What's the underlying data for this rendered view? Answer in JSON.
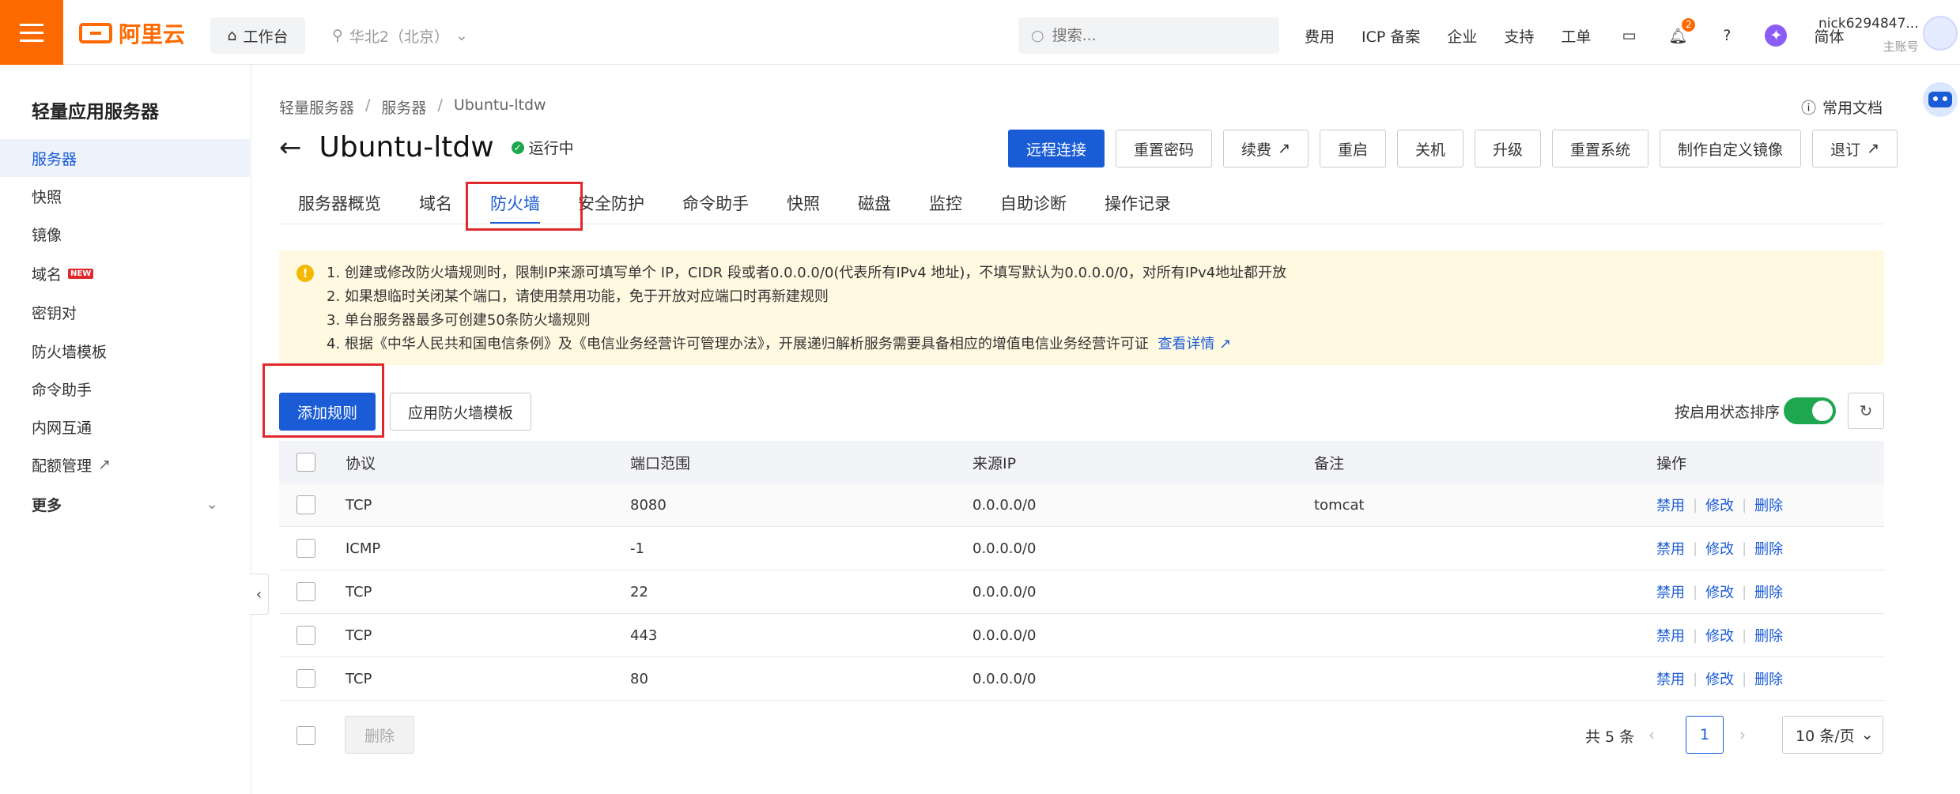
{
  "topbar": {
    "logo_text": "阿里云",
    "workbench": "工作台",
    "region": "华北2（北京）",
    "search_placeholder": "搜索...",
    "links": [
      "费用",
      "ICP 备案",
      "企业",
      "支持",
      "工单"
    ],
    "notification_count": "2",
    "language": "简体",
    "user_name": "nick6294847...",
    "user_role": "主账号"
  },
  "sidebar": {
    "title": "轻量应用服务器",
    "items": [
      {
        "label": "服务器",
        "active": true
      },
      {
        "label": "快照"
      },
      {
        "label": "镜像"
      },
      {
        "label": "域名",
        "tag": "NEW"
      },
      {
        "label": "密钥对"
      },
      {
        "label": "防火墙模板"
      },
      {
        "label": "命令助手"
      },
      {
        "label": "内网互通"
      },
      {
        "label": "配额管理",
        "external": true
      }
    ],
    "more": "更多"
  },
  "breadcrumb": [
    "轻量服务器",
    "服务器",
    "Ubuntu-ltdw"
  ],
  "help_doc": "常用文档",
  "header": {
    "title": "Ubuntu-ltdw",
    "status": "运行中"
  },
  "actions": [
    "远程连接",
    "重置密码",
    "续费",
    "重启",
    "关机",
    "升级",
    "重置系统",
    "制作自定义镜像",
    "退订"
  ],
  "tabs": [
    "服务器概览",
    "域名",
    "防火墙",
    "安全防护",
    "命令助手",
    "快照",
    "磁盘",
    "监控",
    "自助诊断",
    "操作记录"
  ],
  "active_tab": "防火墙",
  "notice": {
    "lines": [
      "1. 创建或修改防火墙规则时，限制IP来源可填写单个 IP，CIDR 段或者0.0.0.0/0(代表所有IPv4 地址)，不填写默认为0.0.0.0/0，对所有IPv4地址都开放",
      "2. 如果想临时关闭某个端口，请使用禁用功能，免于开放对应端口时再新建规则",
      "3. 单台服务器最多可创建50条防火墙规则",
      "4. 根据《中华人民共和国电信条例》及《电信业务经营许可管理办法》，开展递归解析服务需要具备相应的增值电信业务经营许可证"
    ],
    "link": "查看详情"
  },
  "toolbar": {
    "add_rule": "添加规则",
    "apply_template": "应用防火墙模板",
    "sort_label": "按启用状态排序"
  },
  "table": {
    "headers": [
      "协议",
      "端口范围",
      "来源IP",
      "备注",
      "操作"
    ],
    "rows": [
      {
        "protocol": "TCP",
        "port": "8080",
        "source": "0.0.0.0/0",
        "note": "tomcat"
      },
      {
        "protocol": "ICMP",
        "port": "-1",
        "source": "0.0.0.0/0",
        "note": ""
      },
      {
        "protocol": "TCP",
        "port": "22",
        "source": "0.0.0.0/0",
        "note": ""
      },
      {
        "protocol": "TCP",
        "port": "443",
        "source": "0.0.0.0/0",
        "note": ""
      },
      {
        "protocol": "TCP",
        "port": "80",
        "source": "0.0.0.0/0",
        "note": ""
      }
    ],
    "ops": [
      "禁用",
      "修改",
      "删除"
    ]
  },
  "footer": {
    "delete": "删除",
    "total": "共 5 条",
    "page": "1",
    "page_size": "10 条/页"
  },
  "colors": {
    "brand_orange": "#ff6a00",
    "primary_blue": "#1a5bd6",
    "highlight_red": "#e0282d",
    "running_green": "#1fa750"
  }
}
